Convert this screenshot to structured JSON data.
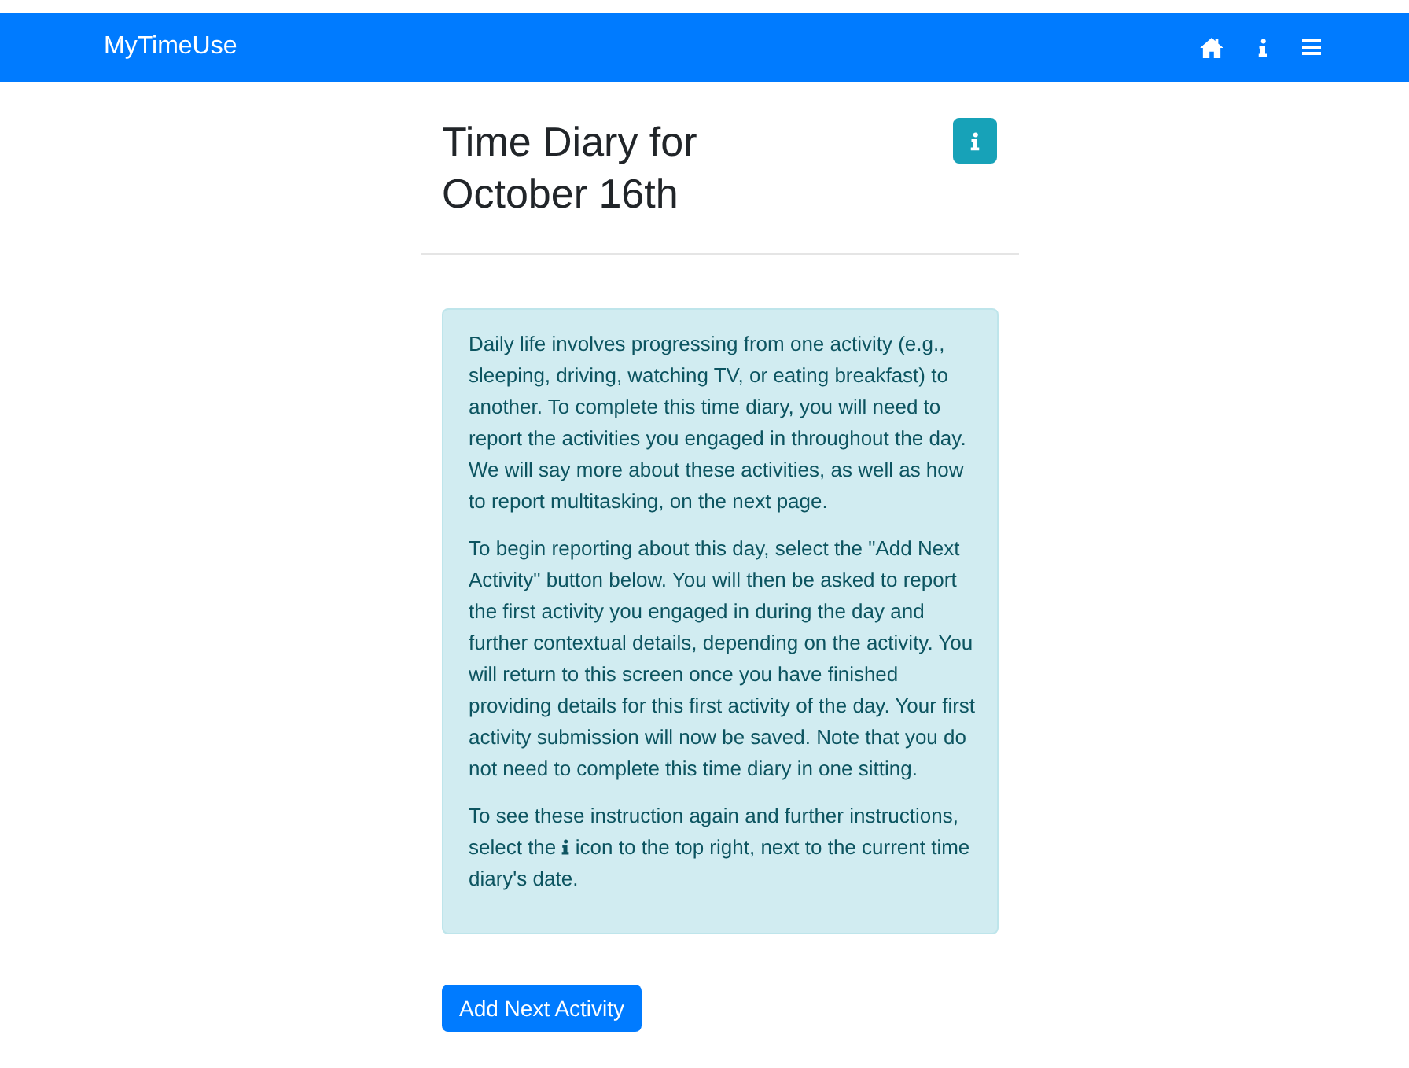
{
  "navbar": {
    "brand": "MyTimeUse"
  },
  "header": {
    "title": "Time Diary for October 16th"
  },
  "instructions": {
    "paragraphs": [
      "Daily life involves progressing from one activity (e.g., sleeping, driving, watching TV, or eating breakfast) to another. To complete this time diary, you will need to report the activities you engaged in throughout the day. We will say more about these activities, as well as how to report multitasking, on the next page.",
      "To begin reporting about this day, select the \"Add Next Activity\" button below. You will then be asked to report the first activity you engaged in during the day and further contextual details, depending on the activity. You will return to this screen once you have finished providing details for this first activity of the day. Your first activity submission will now be saved. Note that you do not need to complete this time diary in one sitting."
    ],
    "last_paragraph": {
      "text_before": "To see these instruction again and further instructions, select the",
      "text_after": "icon to the top right, next to the current time diary's date."
    }
  },
  "buttons": [
    {
      "label": "Add Next Activity"
    }
  ]
}
